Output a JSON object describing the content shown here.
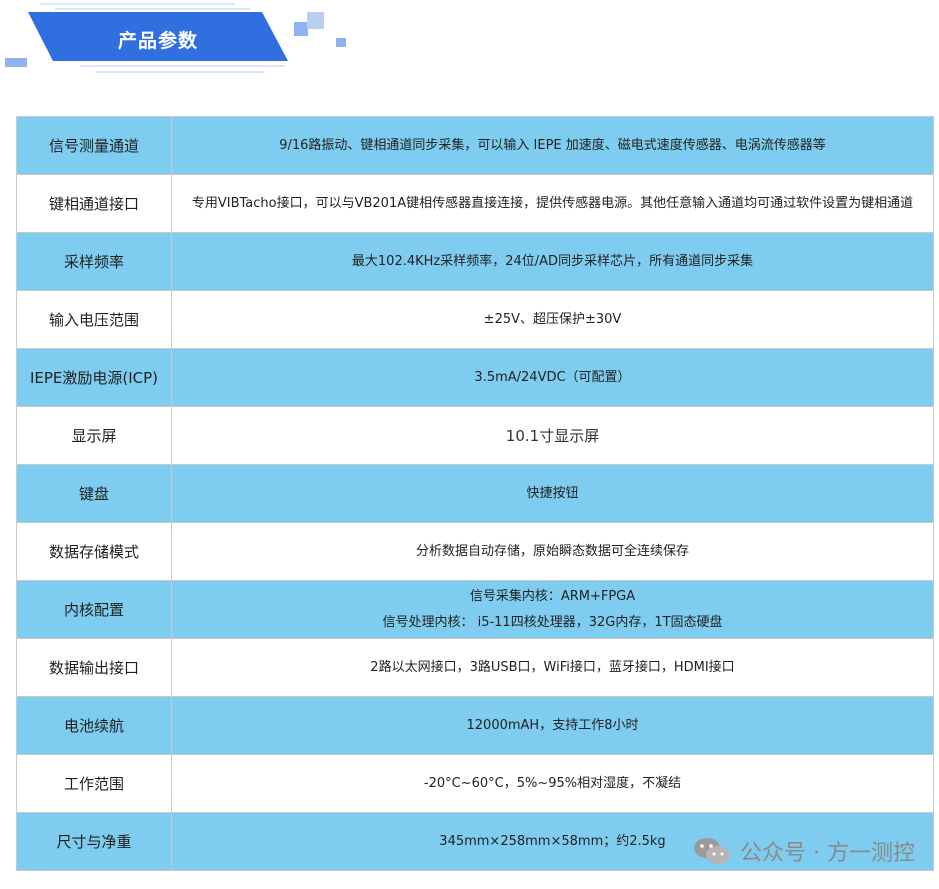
{
  "header": {
    "title": "产品参数"
  },
  "colors": {
    "banner": "#2f6fdf",
    "row_blue": "#7ecdf0",
    "row_white": "#ffffff",
    "accent_square": "#8eb3f0"
  },
  "specs": [
    {
      "label": "信号测量通道",
      "values": [
        "9/16路振动、键相通道同步采集，可以输入 IEPE 加速度、磁电式速度传感器、电涡流传感器等"
      ]
    },
    {
      "label": "键相通道接口",
      "values": [
        "专用VIBTacho接口，可以与VB201A键相传感器直接连接，提供传感器电源。其他任意输入通道均可通过软件设置为键相通道"
      ]
    },
    {
      "label": "采样频率",
      "values": [
        "最大102.4KHz采样频率，24位/AD同步采样芯片，所有通道同步采集"
      ]
    },
    {
      "label": "输入电压范围",
      "values": [
        "±25V、超压保护±30V"
      ]
    },
    {
      "label": "IEPE激励电源(ICP)",
      "values": [
        "3.5mA/24VDC（可配置）"
      ]
    },
    {
      "label": "显示屏",
      "values": [
        "10.1寸显示屏"
      ]
    },
    {
      "label": "键盘",
      "values": [
        "快捷按钮"
      ]
    },
    {
      "label": "数据存储模式",
      "values": [
        "分析数据自动存储，原始瞬态数据可全连续保存"
      ]
    },
    {
      "label": "内核配置",
      "values": [
        "信号采集内核：ARM+FPGA",
        "信号处理内核： i5-11四核处理器，32G内存，1T固态硬盘"
      ]
    },
    {
      "label": "数据输出接口",
      "values": [
        "2路以太网接口，3路USB口，WiFi接口，蓝牙接口，HDMI接口"
      ]
    },
    {
      "label": "电池续航",
      "values": [
        "12000mAH，支持工作8小时"
      ]
    },
    {
      "label": "工作范围",
      "values": [
        "-20°C~60°C，5%~95%相对湿度，不凝结"
      ]
    },
    {
      "label": "尺寸与净重",
      "values": [
        "345mm×258mm×58mm；约2.5kg"
      ]
    }
  ],
  "watermark": {
    "text": "公众号 · 方一测控",
    "icon": "wechat-icon"
  }
}
